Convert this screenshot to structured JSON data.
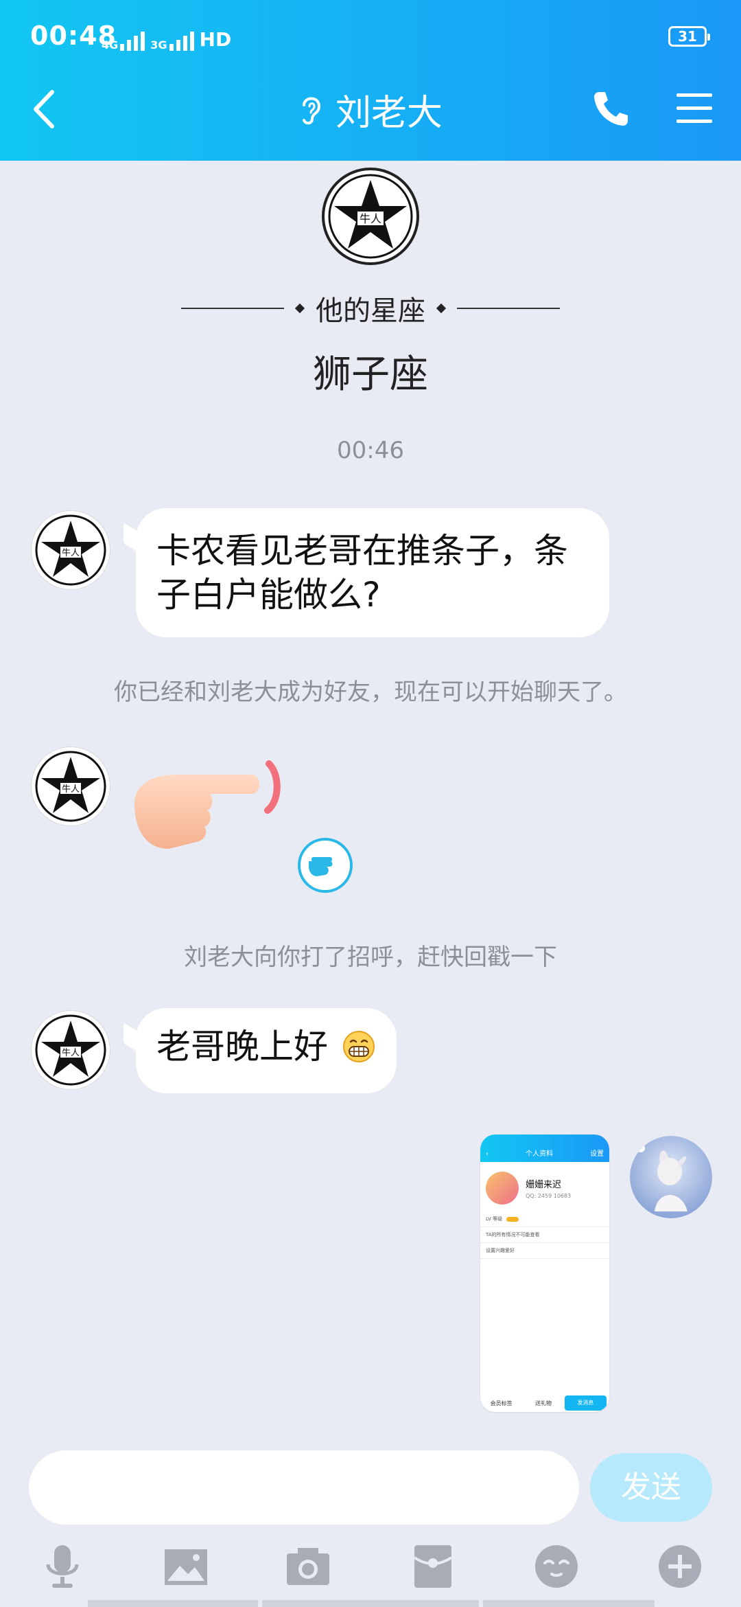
{
  "status_bar": {
    "time": "00:48",
    "network": "HD",
    "net1": "4G",
    "net2": "3G",
    "battery": "31"
  },
  "header": {
    "title": "刘老大"
  },
  "intro": {
    "constellation_label": "他的星座",
    "constellation_value": "狮子座"
  },
  "avatar_text": "牛人",
  "chat": {
    "timestamp": "00:46",
    "msg1": "卡农看见老哥在推条子，条子白户能做么?",
    "system1": "你已经和刘老大成为好友，现在可以开始聊天了。",
    "system2": "刘老大向你打了招呼，赶快回戳一下",
    "msg3": "老哥晚上好"
  },
  "screenshot_preview": {
    "title": "个人资料",
    "settings": "设置",
    "name": "姗姗来迟",
    "qq": "QQ: 2459 10683",
    "row1": "LV 等级",
    "row2": "TA的所有情况不可能查看",
    "row3": "设置兴趣爱好",
    "btn1": "会员标签",
    "btn2": "送礼物",
    "btn3": "发消息"
  },
  "input": {
    "send_label": "发送"
  },
  "colors": {
    "header_start": "#12c7f2",
    "header_end": "#1a98f7",
    "background": "#e8ebf3",
    "send_disabled": "#b5e9fb"
  }
}
